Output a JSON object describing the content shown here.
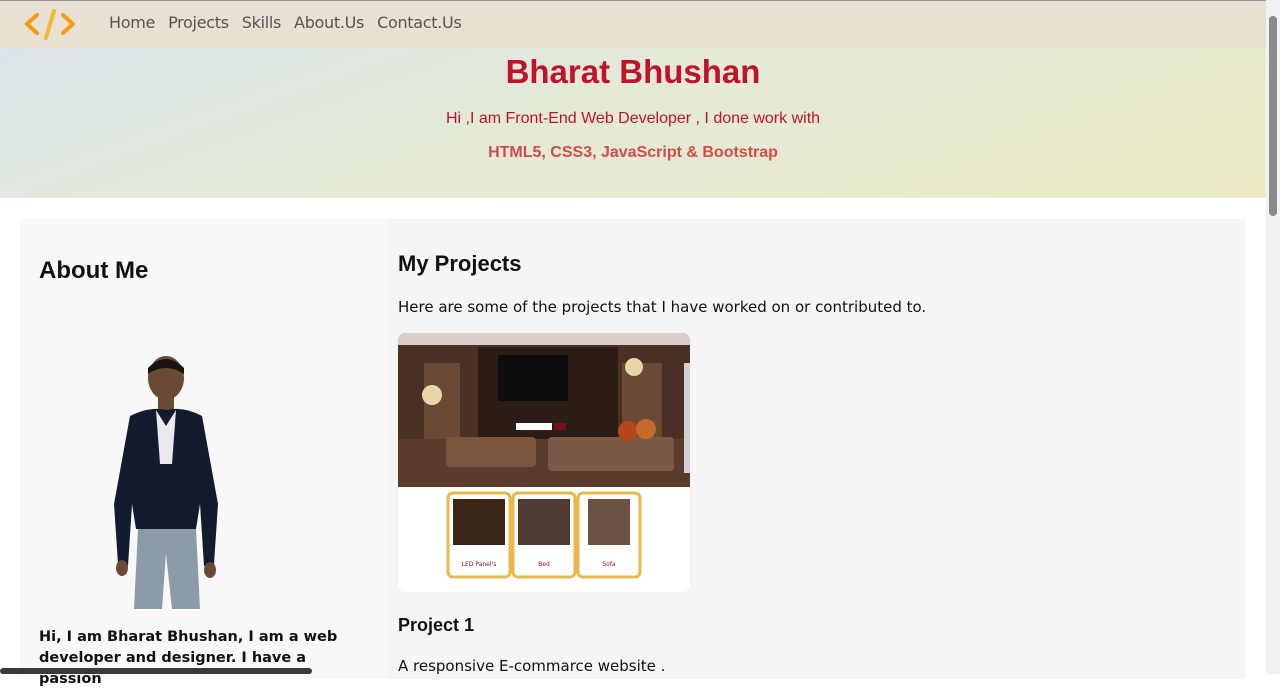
{
  "nav": {
    "items": [
      "Home",
      "Projects",
      "Skills",
      "About.Us",
      "Contact.Us"
    ]
  },
  "hero": {
    "name": "Bharat Bhushan",
    "intro": "Hi ,I am Front-End Web Developer , I done work with",
    "skills": "HTML5, CSS3, JavaScript & Bootstrap"
  },
  "about": {
    "title": "About Me",
    "bio": "Hi, I am Bharat Bhushan, I am a web developer and designer. I have a passion"
  },
  "projects": {
    "title": "My Projects",
    "lead": "Here are some of the projects that I have worked on or contributed to.",
    "thumb": {
      "card_labels": [
        "LED Panel's",
        "Bed",
        "Sofa"
      ]
    },
    "project1": {
      "title": "Project 1",
      "desc": "A responsive E-commarce website ."
    }
  },
  "colors": {
    "accent": "#c0132b",
    "navbar": "#e8e0d2",
    "logo": "#f39c12"
  }
}
